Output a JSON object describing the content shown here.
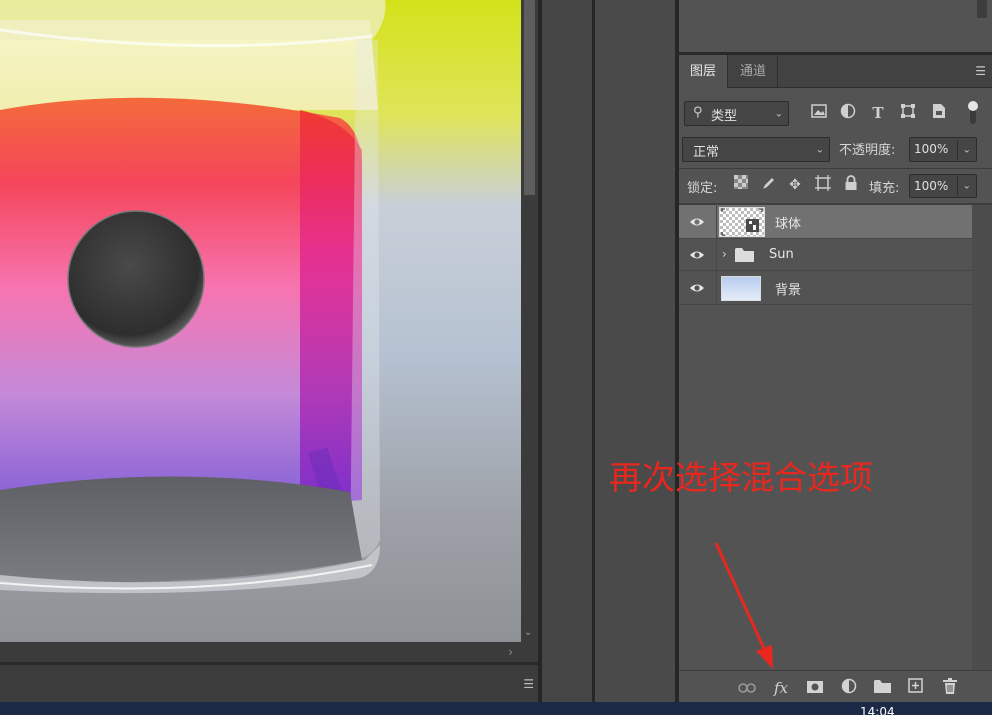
{
  "layers_panel": {
    "tabs": [
      {
        "label": "图层",
        "active": true
      },
      {
        "label": "通道",
        "active": false
      }
    ],
    "panel_menu_icon": "hamburger-icon",
    "filter": {
      "icon": "search-icon",
      "selected": "类型",
      "filter_icons": [
        "image-filter-icon",
        "adjustment-filter-icon",
        "type-filter-icon",
        "shape-filter-icon",
        "smart-object-filter-icon"
      ]
    },
    "blend_mode": "正常",
    "opacity_label": "不透明度:",
    "opacity_value": "100%",
    "lock_label": "锁定:",
    "lock_icons": [
      "lock-transparent-pixels-icon",
      "lock-image-pixels-icon",
      "lock-position-icon",
      "lock-artboard-icon",
      "lock-all-icon"
    ],
    "fill_label": "填充:",
    "fill_value": "100%",
    "layers": [
      {
        "name": "球体",
        "visible": true,
        "selected": true,
        "type": "smart-object"
      },
      {
        "name": "Sun",
        "visible": true,
        "selected": false,
        "type": "group"
      },
      {
        "name": "背景",
        "visible": true,
        "selected": false,
        "type": "gradient"
      }
    ],
    "footer_icons": [
      "link-layers-icon",
      "layer-style-fx-icon",
      "add-mask-icon",
      "adjustment-layer-icon",
      "new-group-icon",
      "new-layer-icon",
      "delete-layer-icon"
    ],
    "footer_fx_label": "fx"
  },
  "annotation": {
    "text": "再次选择混合选项",
    "color": "#e8281e"
  },
  "taskbar": {
    "clock": "14:04"
  },
  "colors": {
    "panel_bg": "#535353",
    "selected_row": "#717171",
    "annotation_red": "#e8281e"
  }
}
